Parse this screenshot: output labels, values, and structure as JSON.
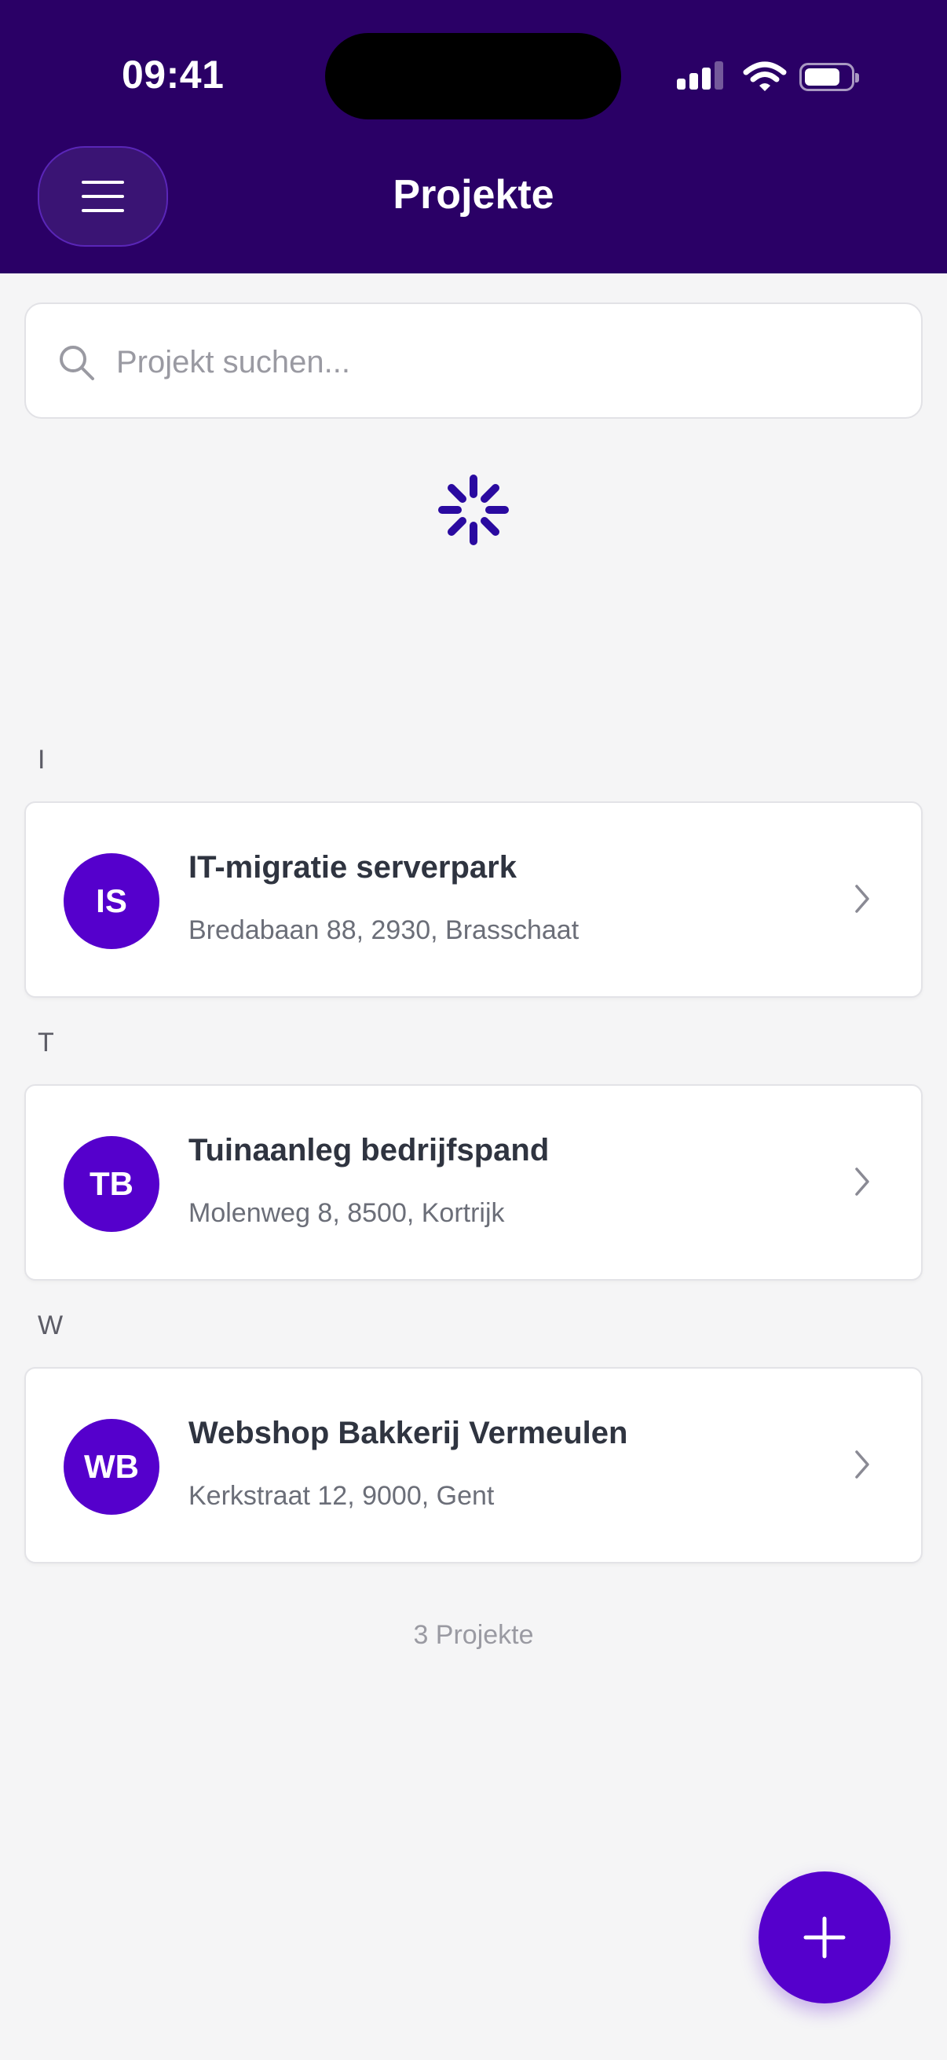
{
  "status_bar": {
    "time": "09:41",
    "icons": [
      "signal-icon",
      "wifi-icon",
      "battery-icon"
    ]
  },
  "header": {
    "title": "Projekte",
    "menu_icon": "hamburger-icon",
    "background": "#2a0066"
  },
  "search": {
    "placeholder": "Projekt suchen...",
    "value": "",
    "icon": "search-icon"
  },
  "loading": {
    "icon": "spinner-icon",
    "color": "#2a0aa0"
  },
  "sections": [
    {
      "letter": "I",
      "project": {
        "initials": "IS",
        "name": "IT-migratie serverpark",
        "address": "Bredabaan 88, 2930, Brasschaat"
      }
    },
    {
      "letter": "T",
      "project": {
        "initials": "TB",
        "name": "Tuinaanleg bedrijfspand",
        "address": "Molenweg 8, 8500, Kortrijk"
      }
    },
    {
      "letter": "W",
      "project": {
        "initials": "WB",
        "name": "Webshop Bakkerij Vermeulen",
        "address": "Kerkstraat 12, 9000, Gent"
      }
    }
  ],
  "footer": {
    "count_label": "3 Projekte"
  },
  "fab": {
    "icon": "plus-icon"
  },
  "colors": {
    "accent": "#5500cc",
    "background": "#f5f5f6",
    "card": "#ffffff"
  }
}
